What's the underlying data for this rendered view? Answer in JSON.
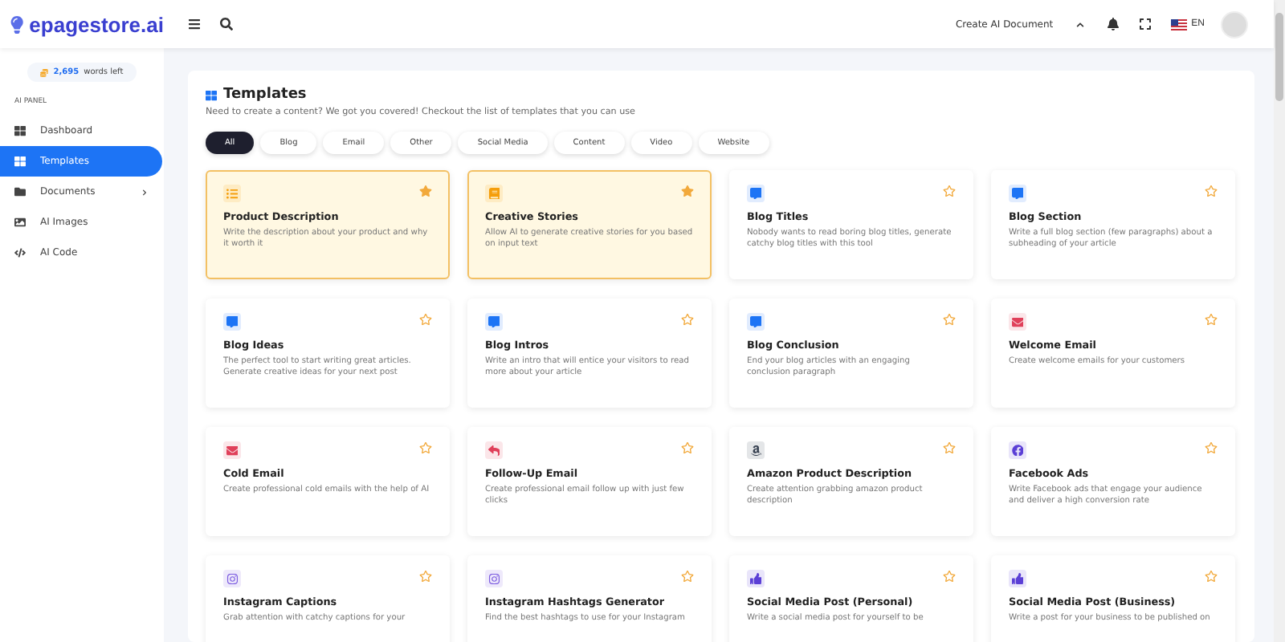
{
  "header": {
    "brand": "epagestore.ai",
    "create_label": "Create AI Document",
    "language": "EN"
  },
  "sidebar": {
    "words_left": {
      "count": "2,695",
      "label": "words left"
    },
    "section": "AI PANEL",
    "items": [
      {
        "label": "Dashboard",
        "kind": "dashboard",
        "selected": false,
        "expandable": false
      },
      {
        "label": "Templates",
        "kind": "templates",
        "selected": true,
        "expandable": false
      },
      {
        "label": "Documents",
        "kind": "documents",
        "selected": false,
        "expandable": true
      },
      {
        "label": "AI Images",
        "kind": "images",
        "selected": false,
        "expandable": false
      },
      {
        "label": "AI Code",
        "kind": "code",
        "selected": false,
        "expandable": false
      }
    ]
  },
  "page": {
    "title": "Templates",
    "subtitle": "Need to create a content? We got you covered! Checkout the list of templates that you can use",
    "filters": [
      {
        "label": "All",
        "selected": true
      },
      {
        "label": "Blog",
        "selected": false
      },
      {
        "label": "Email",
        "selected": false
      },
      {
        "label": "Other",
        "selected": false
      },
      {
        "label": "Social Media",
        "selected": false
      },
      {
        "label": "Content",
        "selected": false
      },
      {
        "label": "Video",
        "selected": false
      },
      {
        "label": "Website",
        "selected": false
      }
    ],
    "templates": [
      {
        "title": "Product Description",
        "description": "Write the description about your product and why it worth it",
        "kind": "list",
        "color": "#f59e0b",
        "favorite": true
      },
      {
        "title": "Creative Stories",
        "description": "Allow AI to generate creative stories for you based on input text",
        "kind": "book",
        "color": "#f59e0b",
        "favorite": true
      },
      {
        "title": "Blog Titles",
        "description": "Nobody wants to read boring blog titles, generate catchy blog titles with this tool",
        "kind": "comment",
        "color": "#1d74f5",
        "favorite": false
      },
      {
        "title": "Blog Section",
        "description": "Write a full blog section (few paragraphs) about a subheading of your article",
        "kind": "comment",
        "color": "#1d74f5",
        "favorite": false
      },
      {
        "title": "Blog Ideas",
        "description": "The perfect tool to start writing great articles. Generate creative ideas for your next post",
        "kind": "comment",
        "color": "#1d74f5",
        "favorite": false
      },
      {
        "title": "Blog Intros",
        "description": "Write an intro that will entice your visitors to read more about your article",
        "kind": "comment",
        "color": "#1d74f5",
        "favorite": false
      },
      {
        "title": "Blog Conclusion",
        "description": "End your blog articles with an engaging conclusion paragraph",
        "kind": "comment",
        "color": "#1d74f5",
        "favorite": false
      },
      {
        "title": "Welcome Email",
        "description": "Create welcome emails for your customers",
        "kind": "mail",
        "color": "#e0405a",
        "favorite": false
      },
      {
        "title": "Cold Email",
        "description": "Create professional cold emails with the help of AI",
        "kind": "mail",
        "color": "#e0405a",
        "favorite": false
      },
      {
        "title": "Follow-Up Email",
        "description": "Create professional email follow up with just few clicks",
        "kind": "reply",
        "color": "#e0405a",
        "favorite": false
      },
      {
        "title": "Amazon Product Description",
        "description": "Create attention grabbing amazon product description",
        "kind": "amazon",
        "color": "#374151",
        "favorite": false
      },
      {
        "title": "Facebook Ads",
        "description": "Write Facebook ads that engage your audience and deliver a high conversion rate",
        "kind": "facebook",
        "color": "#5b3fd6",
        "favorite": false
      },
      {
        "title": "Instagram Captions",
        "description": "Grab attention with catchy captions for your",
        "kind": "instagram",
        "color": "#7c5ce0",
        "favorite": false
      },
      {
        "title": "Instagram Hashtags Generator",
        "description": "Find the best hashtags to use for your Instagram",
        "kind": "instagram",
        "color": "#7c5ce0",
        "favorite": false
      },
      {
        "title": "Social Media Post (Personal)",
        "description": "Write a social media post for yourself to be",
        "kind": "thumbsup",
        "color": "#5b3fd6",
        "favorite": false
      },
      {
        "title": "Social Media Post (Business)",
        "description": "Write a post for your business to be published on",
        "kind": "thumbsup",
        "color": "#5b3fd6",
        "favorite": false
      }
    ]
  }
}
